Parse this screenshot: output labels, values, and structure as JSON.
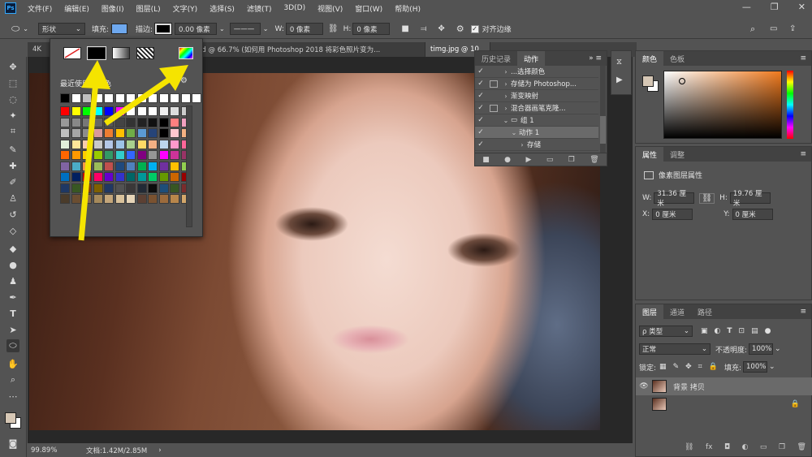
{
  "menubar": {
    "logo": "Ps",
    "items": [
      "文件(F)",
      "编辑(E)",
      "图像(I)",
      "图层(L)",
      "文字(Y)",
      "选择(S)",
      "滤镜(T)",
      "3D(D)",
      "视图(V)",
      "窗口(W)",
      "帮助(H)"
    ],
    "win_min": "—",
    "win_max": "❐",
    "win_close": "✕"
  },
  "options": {
    "mode": "形状",
    "fill_label": "填充:",
    "stroke_label": "描边:",
    "stroke_width": "0.00 像素",
    "w_label": "W:",
    "w_value": "0 像素",
    "h_label": "H:",
    "h_value": "0 像素",
    "align_edges": "对齐边缘",
    "fill_color": "#6ea8ee"
  },
  "tabs": [
    {
      "label": "4K"
    },
    {
      "label": "sd @ 66.7% (如何用 Photoshop 2018 将彩色照片变为..."
    },
    {
      "label": "timg.jpg @ 10"
    }
  ],
  "popup": {
    "recent_title": "最近使用的颜色",
    "gear": "⚙"
  },
  "swatches": {
    "recent": [
      "#000000",
      "#ffffff",
      "#bfbfbf",
      "#ffffff",
      "#ffffff",
      "#ffffff",
      "#ffffff",
      "#ffffff",
      "#ffffff",
      "#ffffff",
      "#ffffff",
      "#ffffff",
      "#ffffff"
    ],
    "rows": [
      [
        "#ff0000",
        "#ffff00",
        "#00ff00",
        "#00ffff",
        "#0000ff",
        "#ff00ff",
        "#ffffff",
        "#ffffff",
        "#ffffff",
        "#eeeeee",
        "#dddddd",
        "#cccccc"
      ],
      [
        "#999999",
        "#888888",
        "#777777",
        "#666666",
        "#555555",
        "#444444",
        "#333333",
        "#222222",
        "#111111",
        "#000000",
        "#ff8080",
        "#f2a0c0"
      ],
      [
        "#bfbfbf",
        "#a6a6a6",
        "#8c8c8c",
        "#d99a9a",
        "#ed7d31",
        "#ffc000",
        "#70ad47",
        "#5b9bd5",
        "#264478",
        "#000000",
        "#ffc7ce",
        "#f4b183"
      ],
      [
        "#e2efda",
        "#ffe699",
        "#f8cbad",
        "#c9c9c9",
        "#b4c7e7",
        "#9dc3e6",
        "#a9d08e",
        "#ffd966",
        "#f4b084",
        "#bdd7ee",
        "#ff99cc",
        "#ff6699"
      ],
      [
        "#ff6600",
        "#ff9900",
        "#ffcc00",
        "#99cc00",
        "#339966",
        "#33cccc",
        "#3366ff",
        "#800080",
        "#969696",
        "#ff00ff",
        "#cc3399",
        "#993366"
      ],
      [
        "#8064a2",
        "#4bacc6",
        "#f79646",
        "#9bbb59",
        "#c0504d",
        "#1f497d",
        "#4f81bd",
        "#00b050",
        "#00b0f0",
        "#7030a0",
        "#ffc000",
        "#92d050"
      ],
      [
        "#0070c0",
        "#002060",
        "#c00000",
        "#ff0066",
        "#6600cc",
        "#3333cc",
        "#006666",
        "#009999",
        "#00cc66",
        "#669900",
        "#cc6600",
        "#990000"
      ],
      [
        "#1f3864",
        "#385723",
        "#833c0b",
        "#7f6000",
        "#203864",
        "#525252",
        "#3a3838",
        "#222a35",
        "#0c0c0c",
        "#1e4e79",
        "#375623",
        "#7b2c2c"
      ],
      [
        "#4a3b2a",
        "#6b4e31",
        "#8c6d46",
        "#a68a5b",
        "#c4a67a",
        "#d9c29b",
        "#e6d5b8",
        "#5c4033",
        "#7a5230",
        "#9c6b3c",
        "#b8864b",
        "#d4a76a"
      ]
    ]
  },
  "history": {
    "tab_history": "历史记录",
    "tab_actions": "动作",
    "items": [
      {
        "check": "✓",
        "dialog": false,
        "arrow": "›",
        "label": "...选择颜色"
      },
      {
        "check": "✓",
        "dialog": true,
        "arrow": "›",
        "label": "存储为 Photoshop..."
      },
      {
        "check": "✓",
        "dialog": false,
        "arrow": "›",
        "label": "渐变映射"
      },
      {
        "check": "✓",
        "dialog": true,
        "arrow": "›",
        "label": "混合器画笔克隆..."
      },
      {
        "check": "✓",
        "dialog": false,
        "arrow": "⌄",
        "label": "组 1"
      },
      {
        "check": "✓",
        "dialog": false,
        "arrow": "⌄",
        "label": "动作 1"
      },
      {
        "check": "✓",
        "dialog": false,
        "arrow": "›",
        "label": "存储"
      }
    ]
  },
  "color_panel": {
    "tab_color": "颜色",
    "tab_swatches": "色板",
    "fg_color": "#d6c7b5"
  },
  "properties": {
    "tab_props": "属性",
    "tab_adjust": "调整",
    "title": "像素图层属性",
    "w_label": "W:",
    "w_value": "31.36 厘米",
    "h_label": "H:",
    "h_value": "19.76 厘米",
    "x_label": "X:",
    "x_value": "0 厘米",
    "y_label": "Y:",
    "y_value": "0 厘米"
  },
  "layers": {
    "tab_layers": "图层",
    "tab_channels": "通道",
    "tab_paths": "路径",
    "filter_label": "ρ 类型",
    "blend_mode": "正常",
    "opacity_label": "不透明度:",
    "opacity_value": "100%",
    "lock_label": "锁定:",
    "fill_label": "填充:",
    "fill_value": "100%",
    "layer_name": "背景 拷贝",
    "footer_icons": [
      "⛓",
      "fx",
      "◘",
      "◐",
      "▭",
      "❐",
      "🗑"
    ]
  },
  "status": {
    "zoom": "99.89%",
    "doc": "文档:1.42M/2.85M",
    "arrow": "›"
  }
}
